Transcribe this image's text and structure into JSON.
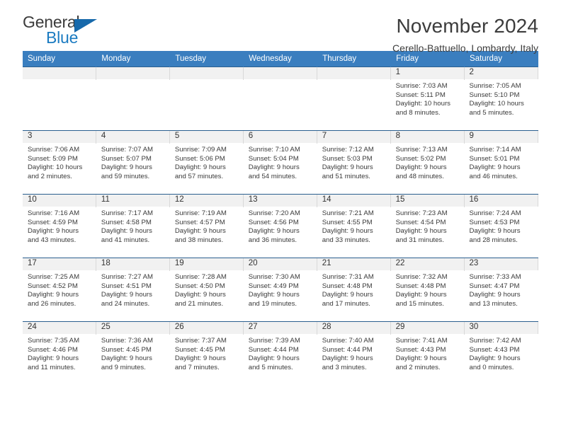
{
  "brand": {
    "name_top": "General",
    "name_bottom": "Blue",
    "accent_color": "#1b7bc1",
    "triangle_color": "#1769ab",
    "top_text_color": "#3b3b3b"
  },
  "header": {
    "title": "November 2024",
    "subtitle": "Cerello-Battuello, Lombardy, Italy"
  },
  "calendar": {
    "header_bg": "#3a7ebf",
    "header_text_color": "#ffffff",
    "daynum_bg": "#f1f1f1",
    "row_border_color": "#2b5f8f",
    "weekdays": [
      "Sunday",
      "Monday",
      "Tuesday",
      "Wednesday",
      "Thursday",
      "Friday",
      "Saturday"
    ],
    "weeks": [
      [
        {
          "day": "",
          "lines": []
        },
        {
          "day": "",
          "lines": []
        },
        {
          "day": "",
          "lines": []
        },
        {
          "day": "",
          "lines": []
        },
        {
          "day": "",
          "lines": []
        },
        {
          "day": "1",
          "lines": [
            "Sunrise: 7:03 AM",
            "Sunset: 5:11 PM",
            "Daylight: 10 hours",
            "and 8 minutes."
          ]
        },
        {
          "day": "2",
          "lines": [
            "Sunrise: 7:05 AM",
            "Sunset: 5:10 PM",
            "Daylight: 10 hours",
            "and 5 minutes."
          ]
        }
      ],
      [
        {
          "day": "3",
          "lines": [
            "Sunrise: 7:06 AM",
            "Sunset: 5:09 PM",
            "Daylight: 10 hours",
            "and 2 minutes."
          ]
        },
        {
          "day": "4",
          "lines": [
            "Sunrise: 7:07 AM",
            "Sunset: 5:07 PM",
            "Daylight: 9 hours",
            "and 59 minutes."
          ]
        },
        {
          "day": "5",
          "lines": [
            "Sunrise: 7:09 AM",
            "Sunset: 5:06 PM",
            "Daylight: 9 hours",
            "and 57 minutes."
          ]
        },
        {
          "day": "6",
          "lines": [
            "Sunrise: 7:10 AM",
            "Sunset: 5:04 PM",
            "Daylight: 9 hours",
            "and 54 minutes."
          ]
        },
        {
          "day": "7",
          "lines": [
            "Sunrise: 7:12 AM",
            "Sunset: 5:03 PM",
            "Daylight: 9 hours",
            "and 51 minutes."
          ]
        },
        {
          "day": "8",
          "lines": [
            "Sunrise: 7:13 AM",
            "Sunset: 5:02 PM",
            "Daylight: 9 hours",
            "and 48 minutes."
          ]
        },
        {
          "day": "9",
          "lines": [
            "Sunrise: 7:14 AM",
            "Sunset: 5:01 PM",
            "Daylight: 9 hours",
            "and 46 minutes."
          ]
        }
      ],
      [
        {
          "day": "10",
          "lines": [
            "Sunrise: 7:16 AM",
            "Sunset: 4:59 PM",
            "Daylight: 9 hours",
            "and 43 minutes."
          ]
        },
        {
          "day": "11",
          "lines": [
            "Sunrise: 7:17 AM",
            "Sunset: 4:58 PM",
            "Daylight: 9 hours",
            "and 41 minutes."
          ]
        },
        {
          "day": "12",
          "lines": [
            "Sunrise: 7:19 AM",
            "Sunset: 4:57 PM",
            "Daylight: 9 hours",
            "and 38 minutes."
          ]
        },
        {
          "day": "13",
          "lines": [
            "Sunrise: 7:20 AM",
            "Sunset: 4:56 PM",
            "Daylight: 9 hours",
            "and 36 minutes."
          ]
        },
        {
          "day": "14",
          "lines": [
            "Sunrise: 7:21 AM",
            "Sunset: 4:55 PM",
            "Daylight: 9 hours",
            "and 33 minutes."
          ]
        },
        {
          "day": "15",
          "lines": [
            "Sunrise: 7:23 AM",
            "Sunset: 4:54 PM",
            "Daylight: 9 hours",
            "and 31 minutes."
          ]
        },
        {
          "day": "16",
          "lines": [
            "Sunrise: 7:24 AM",
            "Sunset: 4:53 PM",
            "Daylight: 9 hours",
            "and 28 minutes."
          ]
        }
      ],
      [
        {
          "day": "17",
          "lines": [
            "Sunrise: 7:25 AM",
            "Sunset: 4:52 PM",
            "Daylight: 9 hours",
            "and 26 minutes."
          ]
        },
        {
          "day": "18",
          "lines": [
            "Sunrise: 7:27 AM",
            "Sunset: 4:51 PM",
            "Daylight: 9 hours",
            "and 24 minutes."
          ]
        },
        {
          "day": "19",
          "lines": [
            "Sunrise: 7:28 AM",
            "Sunset: 4:50 PM",
            "Daylight: 9 hours",
            "and 21 minutes."
          ]
        },
        {
          "day": "20",
          "lines": [
            "Sunrise: 7:30 AM",
            "Sunset: 4:49 PM",
            "Daylight: 9 hours",
            "and 19 minutes."
          ]
        },
        {
          "day": "21",
          "lines": [
            "Sunrise: 7:31 AM",
            "Sunset: 4:48 PM",
            "Daylight: 9 hours",
            "and 17 minutes."
          ]
        },
        {
          "day": "22",
          "lines": [
            "Sunrise: 7:32 AM",
            "Sunset: 4:48 PM",
            "Daylight: 9 hours",
            "and 15 minutes."
          ]
        },
        {
          "day": "23",
          "lines": [
            "Sunrise: 7:33 AM",
            "Sunset: 4:47 PM",
            "Daylight: 9 hours",
            "and 13 minutes."
          ]
        }
      ],
      [
        {
          "day": "24",
          "lines": [
            "Sunrise: 7:35 AM",
            "Sunset: 4:46 PM",
            "Daylight: 9 hours",
            "and 11 minutes."
          ]
        },
        {
          "day": "25",
          "lines": [
            "Sunrise: 7:36 AM",
            "Sunset: 4:45 PM",
            "Daylight: 9 hours",
            "and 9 minutes."
          ]
        },
        {
          "day": "26",
          "lines": [
            "Sunrise: 7:37 AM",
            "Sunset: 4:45 PM",
            "Daylight: 9 hours",
            "and 7 minutes."
          ]
        },
        {
          "day": "27",
          "lines": [
            "Sunrise: 7:39 AM",
            "Sunset: 4:44 PM",
            "Daylight: 9 hours",
            "and 5 minutes."
          ]
        },
        {
          "day": "28",
          "lines": [
            "Sunrise: 7:40 AM",
            "Sunset: 4:44 PM",
            "Daylight: 9 hours",
            "and 3 minutes."
          ]
        },
        {
          "day": "29",
          "lines": [
            "Sunrise: 7:41 AM",
            "Sunset: 4:43 PM",
            "Daylight: 9 hours",
            "and 2 minutes."
          ]
        },
        {
          "day": "30",
          "lines": [
            "Sunrise: 7:42 AM",
            "Sunset: 4:43 PM",
            "Daylight: 9 hours",
            "and 0 minutes."
          ]
        }
      ]
    ]
  }
}
